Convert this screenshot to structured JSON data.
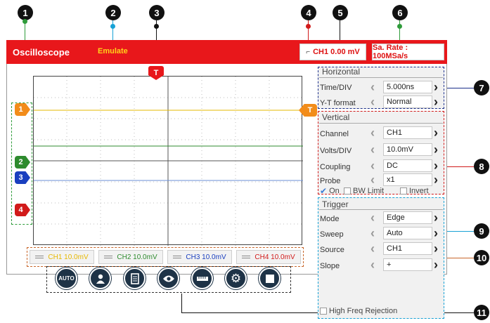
{
  "header": {
    "title": "Oscilloscope",
    "mode": "Emulate",
    "trigger_readout": "CH1 0.00 mV",
    "sample_rate": "Sa. Rate : 100MSa/s"
  },
  "markers": {
    "trigger_top": "T",
    "trigger_right": "T",
    "channels": [
      "1",
      "2",
      "3",
      "4"
    ]
  },
  "channel_buttons": [
    {
      "label": "CH1 10.0mV",
      "color": "#e6b800"
    },
    {
      "label": "CH2 10.0mV",
      "color": "#2e8b2e"
    },
    {
      "label": "CH3 10.0mV",
      "color": "#1a3fbf"
    },
    {
      "label": "CH4 10.0mV",
      "color": "#d11a1a"
    }
  ],
  "toolbar": {
    "auto_label": "AUTO",
    "icons": [
      "auto-icon",
      "person-icon",
      "document-icon",
      "eye-icon",
      "ruler-icon",
      "gear-icon",
      "stop-icon"
    ]
  },
  "horizontal": {
    "title": "Horizontal",
    "time_div_label": "Time/DIV",
    "time_div_value": "5.000ns",
    "yt_label": "Y-T format",
    "yt_value": "Normal"
  },
  "vertical": {
    "title": "Vertical",
    "channel_label": "Channel",
    "channel_value": "CH1",
    "volts_label": "Volts/DIV",
    "volts_value": "10.0mV",
    "coupling_label": "Coupling",
    "coupling_value": "DC",
    "probe_label": "Probe",
    "probe_value": "x1",
    "on_label": "On",
    "bw_label": "BW Limit",
    "invert_label": "Invert"
  },
  "trigger": {
    "title": "Trigger",
    "mode_label": "Mode",
    "mode_value": "Edge",
    "sweep_label": "Sweep",
    "sweep_value": "Auto",
    "source_label": "Source",
    "source_value": "CH1",
    "slope_label": "Slope",
    "slope_value": "+",
    "hfr_label": "High Freq Rejection"
  },
  "callouts": [
    "1",
    "2",
    "3",
    "4",
    "5",
    "6",
    "7",
    "8",
    "9",
    "10",
    "11"
  ],
  "colors": {
    "topbar": "#e8171b",
    "ch1": "#e6b800",
    "ch2": "#2e8b2e",
    "ch3": "#1a3fbf",
    "ch4": "#d11a1a",
    "trigger_marker": "#f28c1a"
  }
}
